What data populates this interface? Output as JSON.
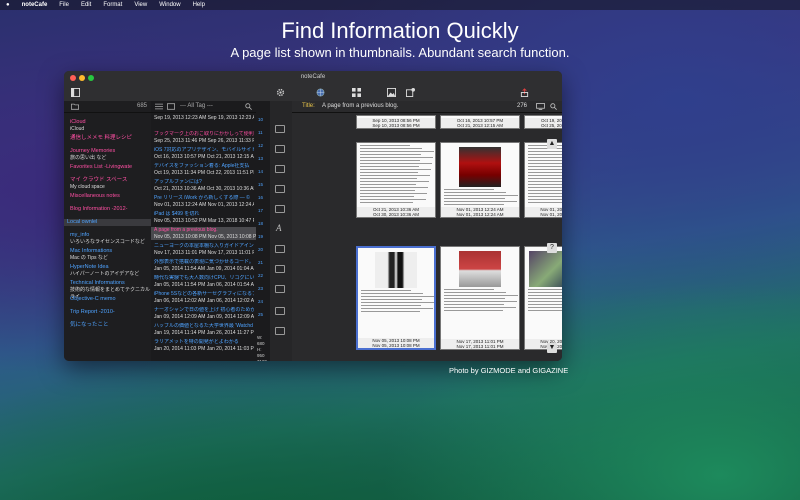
{
  "menubar": {
    "apple": "",
    "app": "noteCafe",
    "items": [
      "File",
      "Edit",
      "Format",
      "View",
      "Window",
      "Help"
    ]
  },
  "headline": "Find Information Quickly",
  "subline": "A page list shown in thumbnails.  Abundant search function.",
  "credit": "Photo by GIZMODE and GIGAZINE",
  "window": {
    "title": "noteCafe",
    "folder_count": "685",
    "tag_filter": "--- All Tag ---",
    "main_title_label": "Title:",
    "main_title": "A page from a previous blog.",
    "page_count": "276",
    "col3_numbers": [
      "10",
      "11",
      "12",
      "13",
      "14",
      "15",
      "16",
      "17",
      "18",
      "19",
      "20",
      "21",
      "22",
      "23",
      "24",
      "25"
    ],
    "w_label": "W: 680",
    "h_label": "H: 950",
    "last_num": "7109"
  },
  "folders": [
    {
      "name": "iCloud",
      "sub": "iCloud",
      "color": "#ff4fa3"
    },
    {
      "name": "通信しメメモ 料理レシピ",
      "sub": "",
      "color": "#ff4fa3"
    },
    {
      "name": "Journey Memories",
      "sub": "旅の思い出 など",
      "color": "#ff4fa3"
    },
    {
      "name": "Favorites List -Livingwate",
      "sub": "",
      "color": "#ff4fa3"
    },
    {
      "name": "マイ クラウド スペース",
      "sub": "My cloud space",
      "color": "#ff4fa3"
    },
    {
      "name": "Miscellaneous notes",
      "sub": "",
      "color": "#ff4fa3"
    },
    {
      "name": "Blog Information -2012-",
      "sub": "",
      "color": "#ff4fa3"
    },
    {
      "name": "Local  ownlel",
      "sub": "",
      "color": "#4fa3ff"
    },
    {
      "name": "my_info",
      "sub": "いろいろなライセンスコードなど",
      "color": "#4fa3ff"
    },
    {
      "name": "Mac Informations",
      "sub": "Mac の Tips など",
      "color": "#4fa3ff"
    },
    {
      "name": "HyperNote Idea",
      "sub": "ハイパーノートのアイデアなど",
      "color": "#4fa3ff"
    },
    {
      "name": "Technical Informations",
      "sub": "技術的な情報をまとめてテクニカルライ",
      "color": "#4fa3ff"
    },
    {
      "name": "Objective-C memo",
      "sub": "",
      "color": "#4fa3ff"
    },
    {
      "name": "Trip Report -2010-",
      "sub": "",
      "color": "#4fa3ff"
    },
    {
      "name": "気になったこと",
      "sub": "",
      "color": "#4fa3ff"
    }
  ],
  "notes": [
    {
      "title": "",
      "date": "Sep 19, 2013 12:23 AM  Sep 19, 2013 12:23 AM",
      "color": "#ff4fa3"
    },
    {
      "title": "ブックマーク上のおこ取りにかかしって便利",
      "date": "Sep 25, 2013 11:46 PM  Sep 26, 2013 11:33 PM",
      "color": "#ff4fa3"
    },
    {
      "title": "iOS 7対応のアプリデザイン、モバイルサイト",
      "date": "Oct 16, 2013 10:57 PM  Oct 21, 2013 12:15 AM",
      "color": "#4fa3ff"
    },
    {
      "title": "デバイスをファッション着る: Apple社支払",
      "date": "Oct 19, 2013 11:34 PM  Oct 22, 2013 11:51 PM",
      "color": "#4fa3ff"
    },
    {
      "title": "アップルファンには?",
      "date": "Oct 21, 2013 10:36 AM  Oct 30, 2013 10:36 AM",
      "color": "#4fa3ff"
    },
    {
      "title": "Pre リリース iWork から新しくする際 — ©",
      "date": "Nov 01, 2013 12:24 AM  Nov 01, 2013 12:24 AM",
      "color": "#4fa3ff"
    },
    {
      "title": "iPad は $499 を切れ",
      "date": "Nov 05, 2013 10:52 PM  Mar 13, 2018 10:47 PM",
      "color": "#4fa3ff"
    },
    {
      "title": "A page from a previous blog.",
      "date": "Nov 05, 2013 10:08 PM  Nov 05, 2013 10:08 PM",
      "color": "#ff4fa3"
    },
    {
      "title": "ニューヨークの本屋本棚な入りガイドアイン",
      "date": "Nov 17, 2013 11:01 PM  Nov 17, 2013 11:01 PM",
      "color": "#4fa3ff"
    },
    {
      "title": "外部表示で搭載の表現に気づかせるコード。よく",
      "date": "Jan 05, 2014 11:54 AM  Jan 09, 2014 01:04 AM",
      "color": "#4fa3ff"
    },
    {
      "title": "時代な実験でも大人数向けCPU、リコグにい",
      "date": "Jan 05, 2014 11:54 PM  Jan 06, 2014 01:54 AM",
      "color": "#4fa3ff"
    },
    {
      "title": "iPhone 5Sなどの各新サーセグラフィになるブ",
      "date": "Jan 06, 2014 12:02 AM  Jan 06, 2014 12:02 AM",
      "color": "#4fa3ff"
    },
    {
      "title": "ナーオシャンで日の値を上げ 初心者のためが",
      "date": "Jan 09, 2014 12:09 AM  Jan 09, 2014 12:09 AM",
      "color": "#4fa3ff"
    },
    {
      "title": "ハッブルの価値となるた大学世界最 'Watchd",
      "date": "Jan 19, 2014 11:14 PM  Jan 26, 2014 11:27 PM",
      "color": "#4fa3ff"
    },
    {
      "title": "ラリアメットを特の開発がとよわかる",
      "date": "Jan 20, 2014 11:03 PM  Jan 20, 2014 11:03 PM",
      "color": "#4fa3ff"
    }
  ],
  "thumbs": [
    {
      "date": "Sep 10, 2013 08:56 PM\nSep 10, 2013 08:56 PM",
      "kind": "text"
    },
    {
      "date": "Oct 16, 2013 10:57 PM\nOct 21, 2013 12:15 AM",
      "kind": "text"
    },
    {
      "date": "Oct 19, 2013 11:58 PM\nOct 25, 2013 12:42 AM",
      "kind": "text"
    },
    {
      "date": "Oct 21, 2013 10:36 AM\nOct 30, 2013 10:36 AM",
      "kind": "text"
    },
    {
      "date": "Nov 01, 2013 12:24 AM\nNov 01, 2013 12:24 AM",
      "kind": "photo-red"
    },
    {
      "date": "Nov 01, 2013 09:20 PM\nNov 01, 2013 09:20 PM",
      "kind": "text"
    },
    {
      "date": "Nov 05, 2013 10:08 PM\nNov 05, 2013 10:08 PM",
      "kind": "photo-wine"
    },
    {
      "date": "Nov 17, 2013 11:01 PM\nNov 17, 2013 11:01 PM",
      "kind": "photo-person"
    },
    {
      "date": "Nov 20, 2013 10:43 PM\nNov 20, 2013 10:43 PM",
      "kind": "photo-screen"
    }
  ]
}
